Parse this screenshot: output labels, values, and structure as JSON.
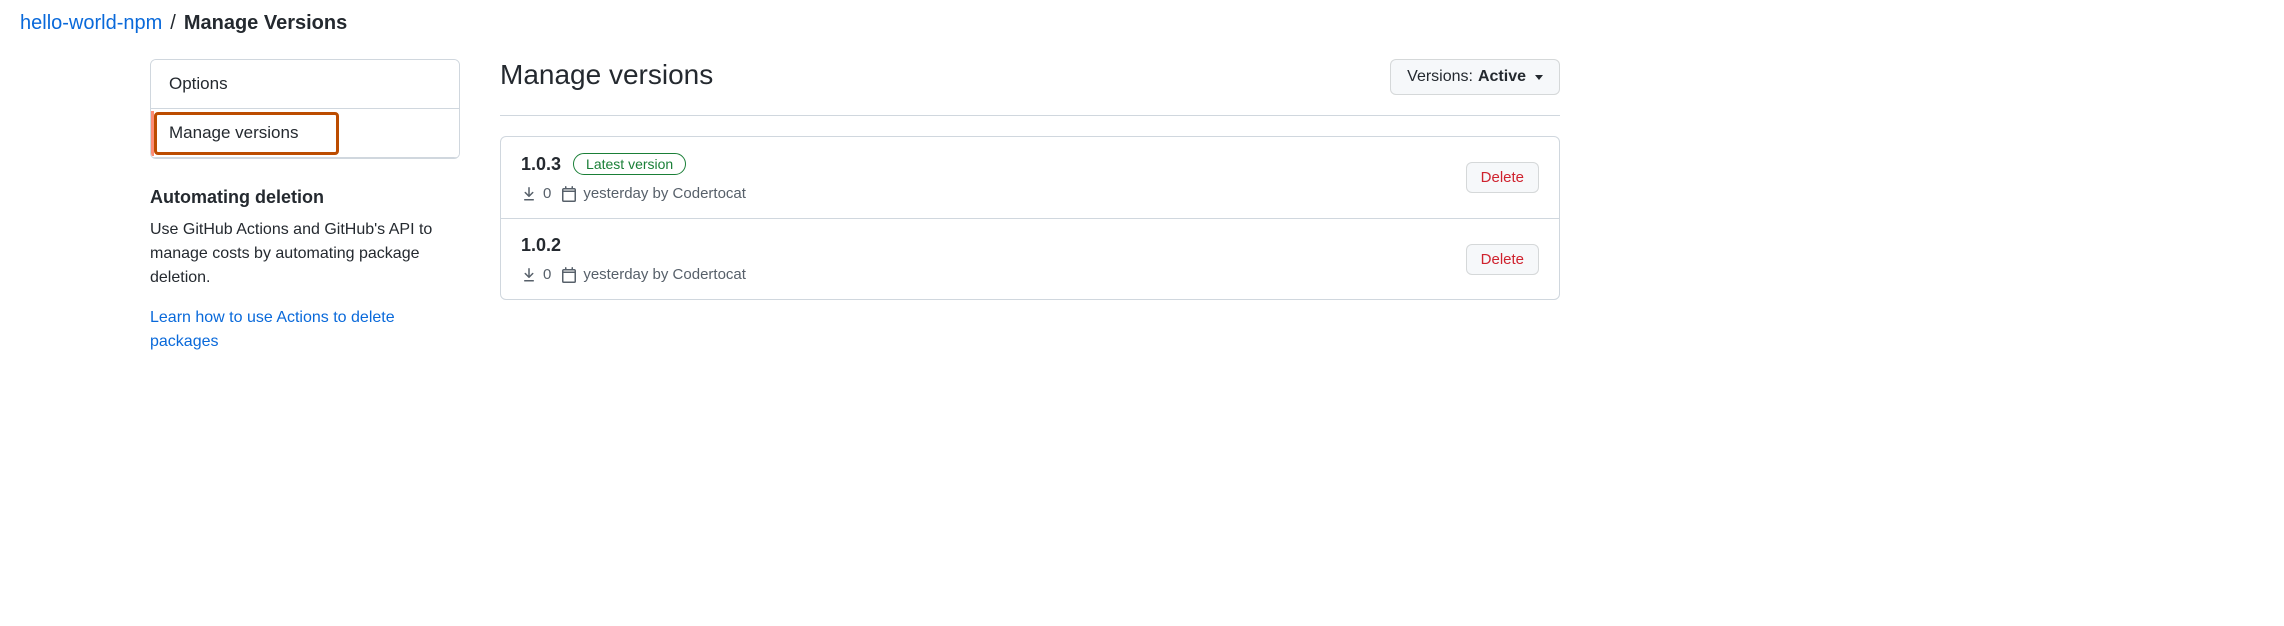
{
  "breadcrumb": {
    "package": "hello-world-npm",
    "current": "Manage Versions"
  },
  "sidebar": {
    "nav": {
      "options": "Options",
      "manage": "Manage versions"
    },
    "automation": {
      "heading": "Automating deletion",
      "text": "Use GitHub Actions and GitHub's API to manage costs by automating package deletion.",
      "link": "Learn how to use Actions to delete packages"
    }
  },
  "main": {
    "title": "Manage versions",
    "filter": {
      "label": "Versions:",
      "value": "Active"
    },
    "delete_label": "Delete",
    "versions": [
      {
        "number": "1.0.3",
        "latest": true,
        "badge": "Latest version",
        "downloads": "0",
        "date": "yesterday",
        "by": "by",
        "author": "Codertocat"
      },
      {
        "number": "1.0.2",
        "latest": false,
        "downloads": "0",
        "date": "yesterday",
        "by": "by",
        "author": "Codertocat"
      }
    ]
  }
}
